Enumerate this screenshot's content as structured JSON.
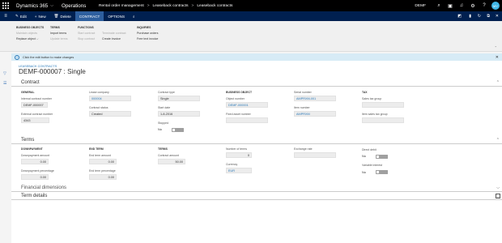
{
  "topbar": {
    "app_name": "Dynamics 365",
    "module": "Operations",
    "breadcrumb": [
      "Rental order management",
      "Leaseback contracts",
      "Leaseback contracts"
    ],
    "company": "DEMF",
    "avatar": "MY"
  },
  "actions": {
    "edit": "Edit",
    "new": "New",
    "delete": "Delete",
    "tab_contract": "CONTRACT",
    "tab_options": "OPTIONS"
  },
  "ribbon": {
    "business_objects": {
      "header": "BUSINESS OBJECTS",
      "items": [
        "Maintain objects",
        "Replace object"
      ]
    },
    "terms": {
      "header": "TERMS",
      "items": [
        "Import terms",
        "Update terms"
      ]
    },
    "functions": {
      "header": "FUNCTIONS",
      "items": [
        "Start contract",
        "Stop contract"
      ]
    },
    "functions2": {
      "items": [
        "Terminate contract",
        "Create invoice"
      ]
    },
    "inquiries": {
      "header": "INQUIRIES",
      "items": [
        "Purchase orders",
        "Free text invoice"
      ]
    }
  },
  "infobar": {
    "message": "Click the edit button to make changes"
  },
  "form": {
    "subtitle": "LEASEBACK CONTRACTS",
    "title": "DEMF-000007 : Single"
  },
  "contract": {
    "header": "Contract",
    "general": {
      "header": "GENERAL",
      "internal_contract_number_label": "Internal contract number",
      "internal_contract_number": "DEMF-000007",
      "external_contract_number_label": "External contract number",
      "external_contract_number": "4343"
    },
    "lease_company_label": "Lease company",
    "lease_company": "000004",
    "contract_status_label": "Contract status",
    "contract_status": "Created",
    "contract_type_label": "Contract type",
    "contract_type": "Single",
    "start_date_label": "Start date",
    "start_date": "1-8-2016",
    "stopped_label": "Stopped",
    "stopped": "No",
    "business_object": {
      "header": "BUSINESS OBJECT",
      "object_number_label": "Object number",
      "object_number": "DEMF-000001",
      "fixed_asset_label": "Fixed asset number",
      "fixed_asset": ""
    },
    "serial_number_label": "Serial number",
    "serial_number": "AMPRXM-001",
    "item_number_label": "Item number",
    "item_number": "AMPRXM",
    "tax": {
      "header": "TAX",
      "sales_tax_group_label": "Sales tax group",
      "sales_tax_group": "",
      "item_sales_tax_group_label": "Item sales tax group",
      "item_sales_tax_group": ""
    }
  },
  "terms": {
    "header": "Terms",
    "downpayment": {
      "header": "DOWNPAYMENT",
      "amount_label": "Downpayment amount",
      "amount": "0.00",
      "percentage_label": "Downpayment percentage",
      "percentage": "0.00"
    },
    "end_term": {
      "header": "END TERM",
      "amount_label": "End term amount",
      "amount": "0.00",
      "percentage_label": "End term percentage",
      "percentage": "0.00"
    },
    "terms_group": {
      "header": "TERMS",
      "contract_amount_label": "Contract amount",
      "contract_amount": "50.00"
    },
    "number_of_terms_label": "Number of terms",
    "number_of_terms": "0",
    "currency_label": "Currency",
    "currency": "EUR",
    "exchange_rate_label": "Exchange rate",
    "exchange_rate": "",
    "direct_debit_label": "Direct debit",
    "direct_debit": "No",
    "variable_interest_label": "Variable interest",
    "variable_interest": "No"
  },
  "sections": {
    "financial_dimensions": "Financial dimensions",
    "term_details": "Term details"
  },
  "colors": {
    "topbar": "#000000",
    "action_pane": "#002050",
    "accent": "#2a79b9",
    "infobar": "#d7ebf6"
  }
}
